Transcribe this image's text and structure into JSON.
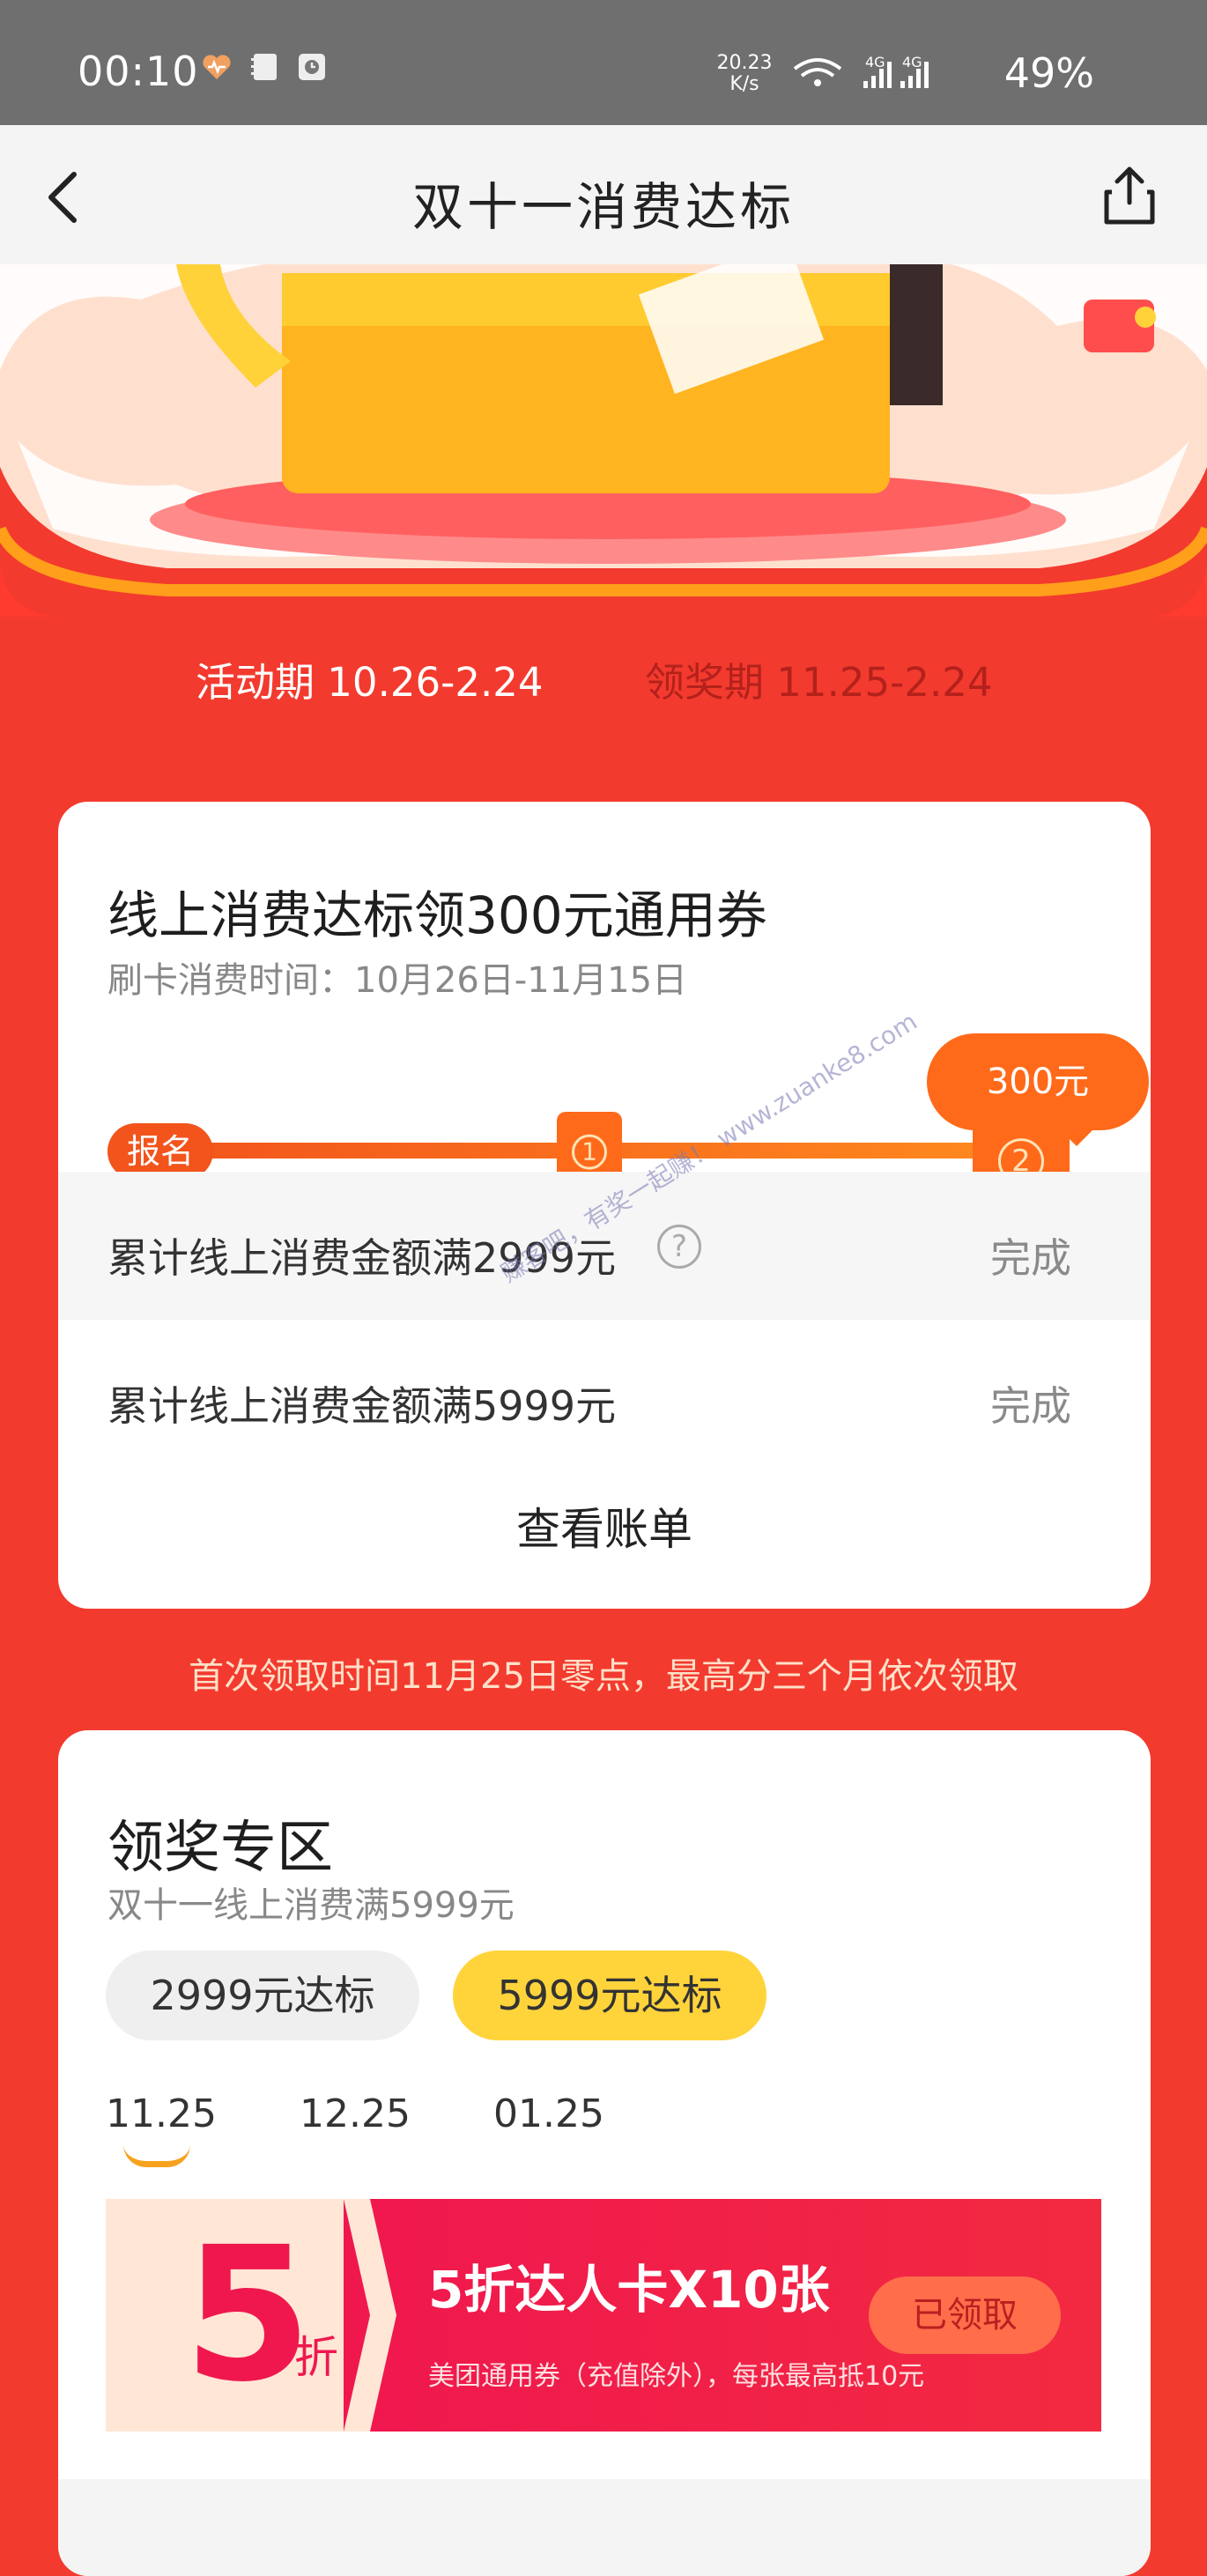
{
  "status_bar": {
    "time": "00:10",
    "net_speed_value": "20.23",
    "net_speed_unit": "K/s",
    "battery": "49%",
    "signal_label_1": "4G",
    "signal_label_2": "4G"
  },
  "header": {
    "title": "双十一消费达标"
  },
  "period": {
    "active": "活动期 10.26-2.24",
    "reward": "领奖期 11.25-2.24"
  },
  "task_card": {
    "heading": "线上消费达标领300元通用券",
    "subtitle": "刷卡消费时间：10月26日-11月15日",
    "start_label": "报名",
    "step1_number": "1",
    "step2_number": "2",
    "reward_bubble": "300元",
    "conditions": [
      {
        "label": "累计线上消费金额满2999元",
        "status": "完成",
        "help": "?"
      },
      {
        "label": "累计线上消费金额满5999元",
        "status": "完成"
      }
    ],
    "view_bill": "查看账单"
  },
  "note": "首次领取时间11月25日零点，最高分三个月依次领取",
  "reward_zone": {
    "heading": "领奖专区",
    "subtitle": "双十一线上消费满5999元",
    "tiers": [
      {
        "label": "2999元达标",
        "selected": false
      },
      {
        "label": "5999元达标",
        "selected": true
      }
    ],
    "dates": [
      "11.25",
      "12.25",
      "01.25"
    ],
    "selected_date_index": 0,
    "coupon": {
      "discount_number": "5",
      "discount_unit": "折",
      "title": "5折达人卡X10张",
      "description": "美团通用券（充值除外），每张最高抵10元",
      "action_label": "已领取"
    }
  },
  "watermark": "赚客吧，有奖一起赚！ www.zuanke8.com",
  "colors": {
    "page_bg": "#f33a2e",
    "accent_orange": "#ff6a1a",
    "selected_tier": "#ffd43b",
    "coupon_red": "#f0174f"
  }
}
